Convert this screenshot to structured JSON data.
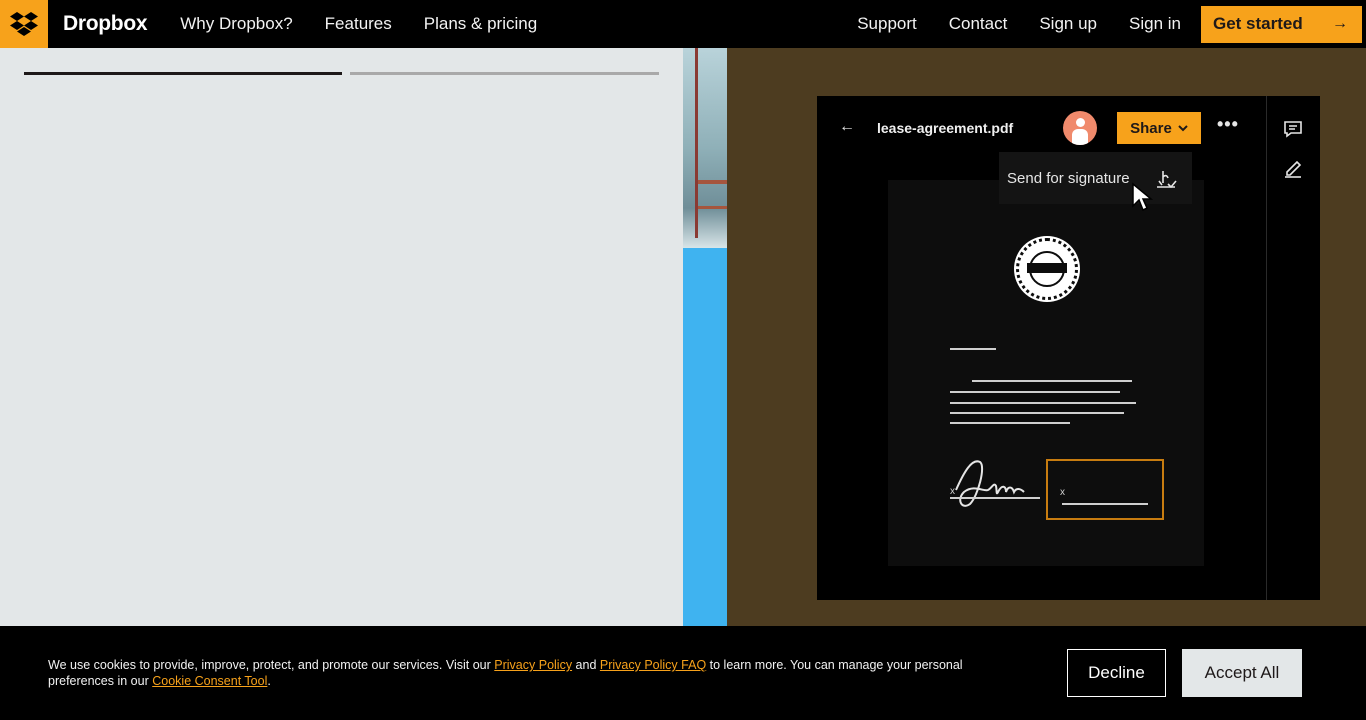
{
  "nav": {
    "brand": "Dropbox",
    "links_left": [
      "Why Dropbox?",
      "Features",
      "Plans & pricing"
    ],
    "links_right": [
      "Support",
      "Contact",
      "Sign up",
      "Sign in"
    ],
    "cta_label": "Get started",
    "cta_icon": "arrow-right-icon",
    "logo_icon": "dropbox-logo-icon"
  },
  "colors": {
    "accent": "#f7a21b",
    "nav_bg": "#000000",
    "left_bg": "#e3e7e8",
    "right_bg": "#4d3c20",
    "strip_blue": "#3fb3f0"
  },
  "progress": {
    "active_segment": 1,
    "segments": 2
  },
  "app_preview": {
    "file_name": "lease-agreement.pdf",
    "share_label": "Share",
    "dropdown_item": "Send for signature",
    "back_icon": "arrow-left-icon",
    "more_icon": "more-horizontal-icon",
    "comment_icon": "comment-icon",
    "edit_icon": "pencil-icon",
    "signature_icon": "signature-icon",
    "cursor_icon": "mouse-cursor-icon"
  },
  "cookie": {
    "text_1": "We use cookies to provide, improve, protect, and promote our services. Visit our ",
    "link_privacy": "Privacy Policy",
    "text_2": " and ",
    "link_faq": "Privacy Policy FAQ",
    "text_3": " to learn more. You can manage your personal preferences in our ",
    "link_tool": "Cookie Consent Tool",
    "text_4": ".",
    "decline_label": "Decline",
    "accept_label": "Accept All"
  }
}
